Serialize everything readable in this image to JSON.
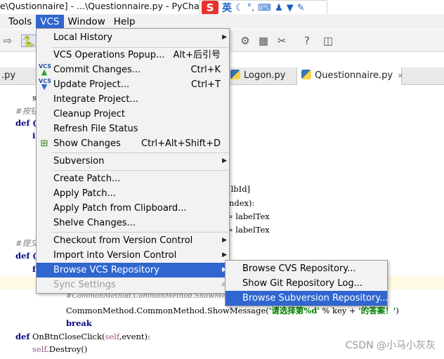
{
  "window": {
    "title": "e\\Qustionnaire] - ...\\Questionnaire.py - PyCharm"
  },
  "ime_bar": {
    "logo": "S",
    "lang": "英",
    "icons": [
      "moon-icon",
      "comma-icon",
      "keyboard-icon",
      "person-icon",
      "shirt-icon",
      "wrench-icon"
    ]
  },
  "menubar": [
    "Tools",
    "VCS",
    "Window",
    "Help"
  ],
  "tabs": [
    {
      "label": ".py"
    },
    {
      "label": "Logon.py"
    },
    {
      "label": "Questionnaire.py",
      "close": "×"
    }
  ],
  "code": {
    "l1": "s",
    "l2": "#按钮",
    "l3": "def (",
    "l4": "i",
    "l5": "rt[lbId]",
    "l6": "nIndex):",
    "l7": "= labelTex",
    "l8": "= labelTex",
    "l9": "#提交",
    "l10": "def (",
    "l11": "f",
    "l12": "#CommonMethod.CommonMethod.ShowMessage",
    "l13a": "CommonMethod.CommonMethod.ShowMessage(",
    "l13b": "'请选择第%d'",
    "l13c": " % key + ",
    "l13d": "'的答案！'",
    "l13e": ")",
    "l14": "break",
    "l15a": "def",
    "l15b": " OnBtnCloseClick(",
    "l15c": "self",
    "l15d": ",event):",
    "l16a": "self",
    "l16b": ".Destroy()"
  },
  "vcs_menu": {
    "items": [
      {
        "label": "Local History",
        "arrow": "▶"
      },
      {
        "label": "VCS Operations Popup...",
        "shortcut": "Alt+后引号"
      },
      {
        "label": "Commit Changes...",
        "shortcut": "Ctrl+K",
        "icon": "VCS"
      },
      {
        "label": "Update Project...",
        "shortcut": "Ctrl+T",
        "icon": "VCS"
      },
      {
        "label": "Integrate Project..."
      },
      {
        "label": "Cleanup Project"
      },
      {
        "label": "Refresh File Status"
      },
      {
        "label": "Show Changes",
        "shortcut": "Ctrl+Alt+Shift+D"
      },
      {
        "label": "Subversion",
        "arrow": "▶"
      },
      {
        "label": "Create Patch..."
      },
      {
        "label": "Apply Patch..."
      },
      {
        "label": "Apply Patch from Clipboard..."
      },
      {
        "label": "Shelve Changes..."
      },
      {
        "label": "Checkout from Version Control",
        "arrow": "▶"
      },
      {
        "label": "Import into Version Control",
        "arrow": "▶"
      },
      {
        "label": "Browse VCS Repository",
        "arrow": "▶"
      },
      {
        "label": "Sync Settings",
        "arrow": "▶"
      }
    ]
  },
  "browse_submenu": {
    "items": [
      {
        "label": "Browse CVS Repository..."
      },
      {
        "label": "Show Git Repository Log..."
      },
      {
        "label": "Browse Subversion Repository..."
      }
    ]
  },
  "watermark": "CSDN @小马小灰灰",
  "colors": {
    "highlight": "#2f66cf",
    "menu_bg": "#f2f2f2"
  }
}
